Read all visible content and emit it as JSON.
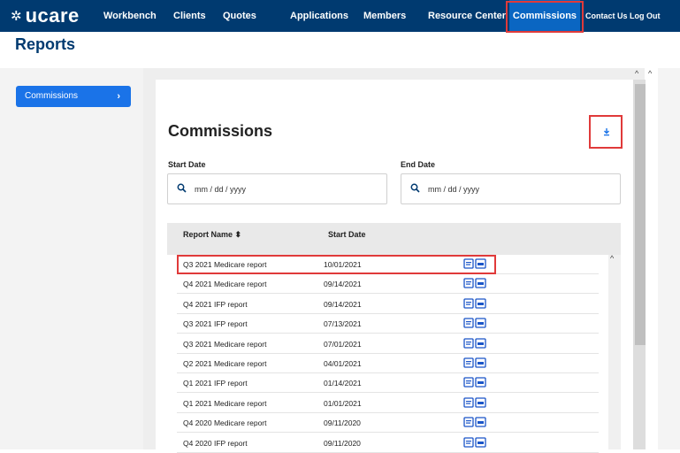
{
  "brand": {
    "logo_text": "ucare",
    "logo_mark": "✲"
  },
  "nav": {
    "items": [
      {
        "label": "Workbench"
      },
      {
        "label": "Clients"
      },
      {
        "label": "Quotes"
      },
      {
        "label": "Applications"
      },
      {
        "label": "Members"
      },
      {
        "label": "Resource Center"
      },
      {
        "label": "Commissions"
      },
      {
        "label": "Contact Us"
      },
      {
        "label": "Log Out"
      }
    ],
    "active": "Commissions"
  },
  "page": {
    "title": "Reports"
  },
  "sidebar": {
    "items": [
      {
        "label": "Commissions",
        "chevron": "›"
      }
    ]
  },
  "main": {
    "title": "Commissions",
    "download_icon": "download-icon",
    "start_date": {
      "label": "Start Date",
      "placeholder": "mm / dd / yyyy"
    },
    "end_date": {
      "label": "End Date",
      "placeholder": "mm / dd / yyyy"
    },
    "table": {
      "columns": [
        "Report Name ⬍",
        "Start Date"
      ],
      "rows": [
        {
          "name": "Q3 2021 Medicare report",
          "start": "10/01/2021"
        },
        {
          "name": "Q4 2021 Medicare report",
          "start": "09/14/2021"
        },
        {
          "name": "Q4 2021 IFP report",
          "start": "09/14/2021"
        },
        {
          "name": "Q3 2021 IFP report",
          "start": "07/13/2021"
        },
        {
          "name": "Q3 2021 Medicare report",
          "start": "07/01/2021"
        },
        {
          "name": "Q2 2021 Medicare report",
          "start": "04/01/2021"
        },
        {
          "name": "Q1 2021 IFP report",
          "start": "01/14/2021"
        },
        {
          "name": "Q1 2021 Medicare report",
          "start": "01/01/2021"
        },
        {
          "name": "Q4 2020 Medicare report",
          "start": "09/11/2020"
        },
        {
          "name": "Q4 2020 IFP report",
          "start": "09/11/2020"
        }
      ]
    }
  },
  "colors": {
    "nav_bg": "#003a70",
    "active_tab": "#0a66c2",
    "highlight": "#e03a3a",
    "link_blue": "#1a73e8"
  }
}
